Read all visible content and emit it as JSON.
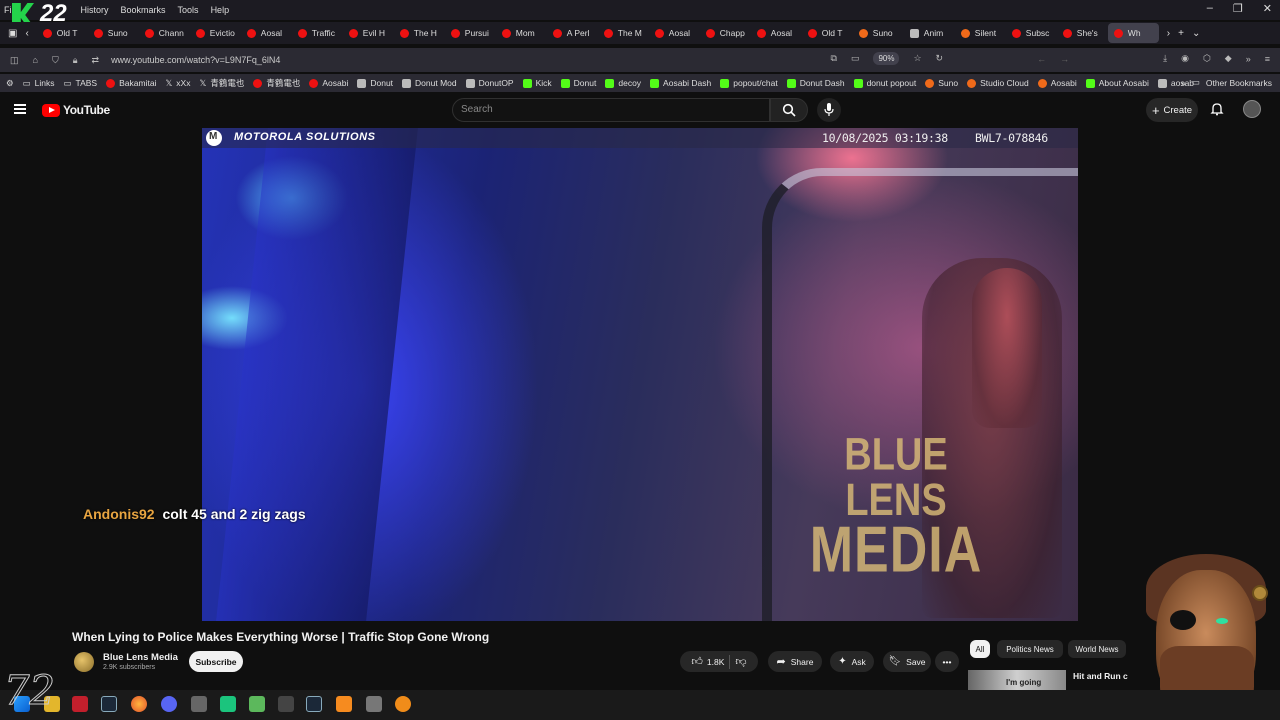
{
  "menu": {
    "file": "File",
    "history": "History",
    "bookmarks": "Bookmarks",
    "tools": "Tools",
    "help": "Help"
  },
  "overlay_logo": {
    "number": "22"
  },
  "tabs": [
    "Old T",
    "Suno",
    "Chann",
    "Evictio",
    "Aosal",
    "Traffic",
    "Evil H",
    "The H",
    "Pursui",
    "Mom",
    "A Perl",
    "The M",
    "Aosal",
    "Chapp",
    "Aosal",
    "Old T",
    "Suno",
    "Anim",
    "Silent",
    "Subsc",
    "She's",
    "Wh"
  ],
  "address": {
    "url": "www.youtube.com/watch?v=L9N7Fq_6lN4",
    "zoom": "90%"
  },
  "bookmarks": [
    "Links",
    "TABS",
    "Bakamitai",
    "xXx",
    "青鶴電也",
    "青鶴電也",
    "Aosabi",
    "Donut",
    "Donut Mod",
    "DonutOP",
    "Kick",
    "Donut",
    "decoy",
    "Aosabi Dash",
    "popout/chat",
    "Donut Dash",
    "donut popout",
    "Suno",
    "Studio Cloud",
    "Aosabi",
    "About Aosabi",
    "aosab"
  ],
  "bookmarks_other": "Other Bookmarks",
  "youtube": {
    "brand": "YouTube",
    "search_placeholder": "Search",
    "create_label": "Create"
  },
  "video": {
    "overlay_brand": "MOTOROLA SOLUTIONS",
    "timestamp": "10/08/2025 03:19:38",
    "device_id": "BWL7-078846",
    "watermark_line1": "BLUE LENS",
    "watermark_line2": "MEDIA",
    "title": "When Lying to Police Makes Everything Worse | Traffic Stop Gone Wrong"
  },
  "chat_overlay": {
    "username": "Andonis92",
    "message": "colt 45 and 2 zig zags"
  },
  "channel": {
    "name": "Blue Lens Media",
    "subscribers": "2.9K subscribers",
    "subscribe_label": "Subscribe"
  },
  "actions": {
    "likes": "1.8K",
    "share": "Share",
    "ask": "Ask",
    "save": "Save"
  },
  "chips": [
    "All",
    "Politics News",
    "World News"
  ],
  "recommended": {
    "thumb_text": "I'm going",
    "title": "Hit and Run c"
  },
  "colors": {
    "accent_red": "#ff0000",
    "chat_username": "#e8a541",
    "background": "#0f0f0f"
  }
}
